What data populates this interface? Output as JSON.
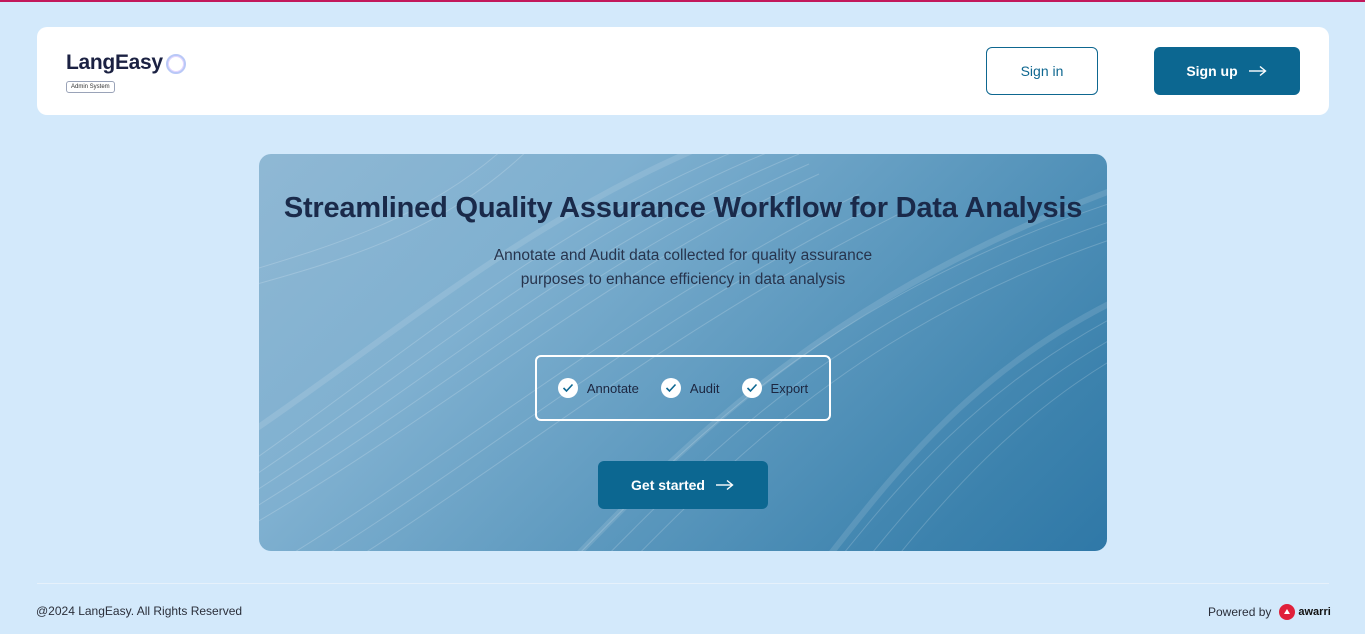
{
  "header": {
    "logo_text": "LangEasy",
    "logo_badge": "Admin System",
    "signin_label": "Sign in",
    "signup_label": "Sign up"
  },
  "hero": {
    "title": "Streamlined Quality Assurance Workflow for Data Analysis",
    "subtitle": "Annotate and Audit data collected for quality assurance purposes to enhance efficiency in data analysis",
    "features": [
      {
        "label": "Annotate",
        "icon": "check-icon"
      },
      {
        "label": "Audit",
        "icon": "check-icon"
      },
      {
        "label": "Export",
        "icon": "check-icon"
      }
    ],
    "cta_label": "Get started"
  },
  "footer": {
    "copyright": "@2024 LangEasy. All Rights Reserved",
    "powered_by": "Powered by",
    "partner_name": "awarri"
  },
  "colors": {
    "primary": "#0c6791",
    "background": "#d3e9fb",
    "top_border": "#c2185b",
    "partner_red": "#e0203a"
  }
}
